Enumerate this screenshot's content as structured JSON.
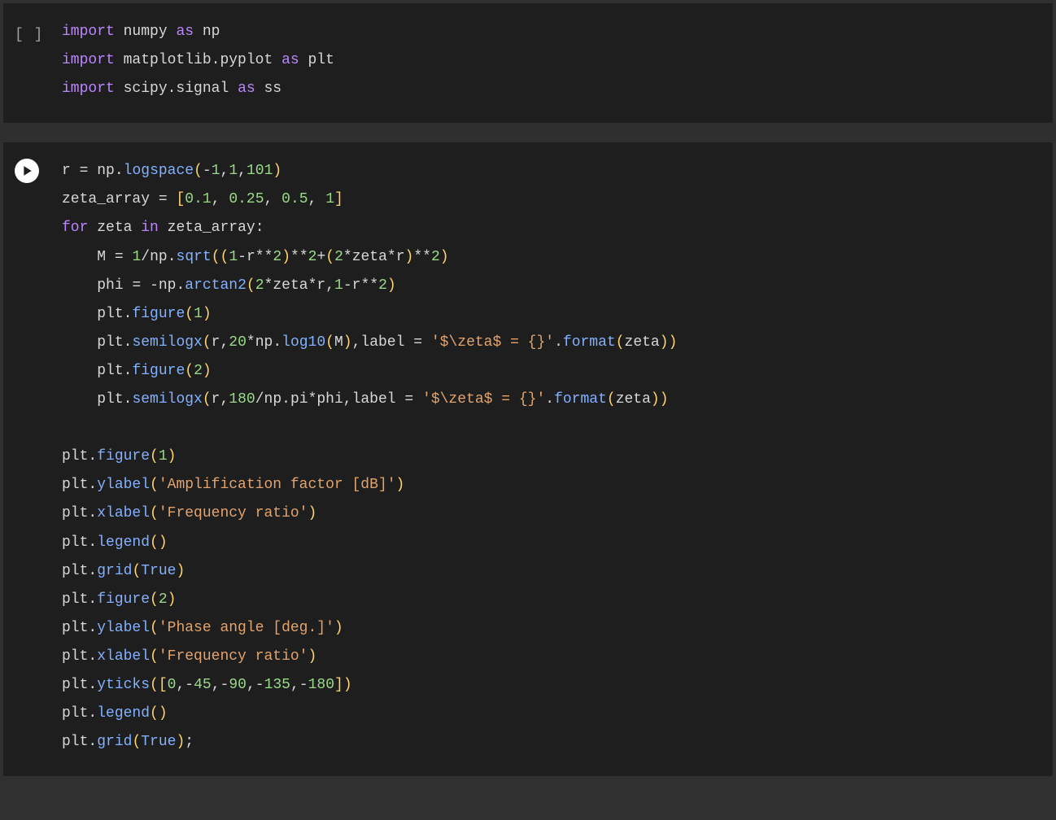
{
  "cells": [
    {
      "state": "idle",
      "gutter": "[ ]",
      "code_html": "<span class=\"kw\">import</span> <span class=\"plain\">numpy</span> <span class=\"kw\">as</span> <span class=\"plain\">np</span>\n<span class=\"kw\">import</span> <span class=\"plain\">matplotlib.pyplot</span> <span class=\"kw\">as</span> <span class=\"plain\">plt</span>\n<span class=\"kw\">import</span> <span class=\"plain\">scipy.signal</span> <span class=\"kw\">as</span> <span class=\"plain\">ss</span>"
    },
    {
      "state": "active",
      "code_html": "<span class=\"plain\">r</span> <span class=\"op\">=</span> <span class=\"plain\">np</span><span class=\"op\">.</span><span class=\"fn\">logspace</span><span class=\"pun\">(</span><span class=\"op\">-</span><span class=\"num\">1</span><span class=\"op\">,</span><span class=\"num\">1</span><span class=\"op\">,</span><span class=\"num\">101</span><span class=\"pun\">)</span>\n<span class=\"plain\">zeta_array</span> <span class=\"op\">=</span> <span class=\"pun\">[</span><span class=\"num\">0.1</span><span class=\"op\">,</span> <span class=\"num\">0.25</span><span class=\"op\">,</span> <span class=\"num\">0.5</span><span class=\"op\">,</span> <span class=\"num\">1</span><span class=\"pun\">]</span>\n<span class=\"kw\">for</span> <span class=\"plain\">zeta</span> <span class=\"kw\">in</span> <span class=\"plain\">zeta_array</span><span class=\"op\">:</span>\n    <span class=\"plain\">M</span> <span class=\"op\">=</span> <span class=\"num\">1</span><span class=\"op\">/</span><span class=\"plain\">np</span><span class=\"op\">.</span><span class=\"fn\">sqrt</span><span class=\"pun\">(</span><span class=\"pun\">(</span><span class=\"num\">1</span><span class=\"op\">-</span><span class=\"plain\">r</span><span class=\"op\">**</span><span class=\"num\">2</span><span class=\"pun\">)</span><span class=\"op\">**</span><span class=\"num\">2</span><span class=\"op\">+</span><span class=\"pun\">(</span><span class=\"num\">2</span><span class=\"op\">*</span><span class=\"plain\">zeta</span><span class=\"op\">*</span><span class=\"plain\">r</span><span class=\"pun\">)</span><span class=\"op\">**</span><span class=\"num\">2</span><span class=\"pun\">)</span>\n    <span class=\"plain\">phi</span> <span class=\"op\">=</span> <span class=\"op\">-</span><span class=\"plain\">np</span><span class=\"op\">.</span><span class=\"fn\">arctan2</span><span class=\"pun\">(</span><span class=\"num\">2</span><span class=\"op\">*</span><span class=\"plain\">zeta</span><span class=\"op\">*</span><span class=\"plain\">r</span><span class=\"op\">,</span><span class=\"num\">1</span><span class=\"op\">-</span><span class=\"plain\">r</span><span class=\"op\">**</span><span class=\"num\">2</span><span class=\"pun\">)</span>\n    <span class=\"plain\">plt</span><span class=\"op\">.</span><span class=\"fn\">figure</span><span class=\"pun\">(</span><span class=\"num\">1</span><span class=\"pun\">)</span>\n    <span class=\"plain\">plt</span><span class=\"op\">.</span><span class=\"fn\">semilogx</span><span class=\"pun\">(</span><span class=\"plain\">r</span><span class=\"op\">,</span><span class=\"num\">20</span><span class=\"op\">*</span><span class=\"plain\">np</span><span class=\"op\">.</span><span class=\"fn\">log10</span><span class=\"pun\">(</span><span class=\"plain\">M</span><span class=\"pun\">)</span><span class=\"op\">,</span><span class=\"plain\">label</span> <span class=\"op\">=</span> <span class=\"str\">'$\\zeta$ = {}'</span><span class=\"op\">.</span><span class=\"fn\">format</span><span class=\"pun\">(</span><span class=\"plain\">zeta</span><span class=\"pun\">)</span><span class=\"pun\">)</span>\n    <span class=\"plain\">plt</span><span class=\"op\">.</span><span class=\"fn\">figure</span><span class=\"pun\">(</span><span class=\"num\">2</span><span class=\"pun\">)</span>\n    <span class=\"plain\">plt</span><span class=\"op\">.</span><span class=\"fn\">semilogx</span><span class=\"pun\">(</span><span class=\"plain\">r</span><span class=\"op\">,</span><span class=\"num\">180</span><span class=\"op\">/</span><span class=\"plain\">np</span><span class=\"op\">.</span><span class=\"plain\">pi</span><span class=\"op\">*</span><span class=\"plain\">phi</span><span class=\"op\">,</span><span class=\"plain\">label</span> <span class=\"op\">=</span> <span class=\"str\">'$\\zeta$ = {}'</span><span class=\"op\">.</span><span class=\"fn\">format</span><span class=\"pun\">(</span><span class=\"plain\">zeta</span><span class=\"pun\">)</span><span class=\"pun\">)</span>\n\n<span class=\"plain\">plt</span><span class=\"op\">.</span><span class=\"fn\">figure</span><span class=\"pun\">(</span><span class=\"num\">1</span><span class=\"pun\">)</span>\n<span class=\"plain\">plt</span><span class=\"op\">.</span><span class=\"fn\">ylabel</span><span class=\"pun\">(</span><span class=\"str\">'Amplification factor [dB]'</span><span class=\"pun\">)</span>\n<span class=\"plain\">plt</span><span class=\"op\">.</span><span class=\"fn\">xlabel</span><span class=\"pun\">(</span><span class=\"str\">'Frequency ratio'</span><span class=\"pun\">)</span>\n<span class=\"plain\">plt</span><span class=\"op\">.</span><span class=\"fn\">legend</span><span class=\"pun\">(</span><span class=\"pun\">)</span>\n<span class=\"plain\">plt</span><span class=\"op\">.</span><span class=\"fn\">grid</span><span class=\"pun\">(</span><span class=\"bool\">True</span><span class=\"pun\">)</span>\n<span class=\"plain\">plt</span><span class=\"op\">.</span><span class=\"fn\">figure</span><span class=\"pun\">(</span><span class=\"num\">2</span><span class=\"pun\">)</span>\n<span class=\"plain\">plt</span><span class=\"op\">.</span><span class=\"fn\">ylabel</span><span class=\"pun\">(</span><span class=\"str\">'Phase angle [deg.]'</span><span class=\"pun\">)</span>\n<span class=\"plain\">plt</span><span class=\"op\">.</span><span class=\"fn\">xlabel</span><span class=\"pun\">(</span><span class=\"str\">'Frequency ratio'</span><span class=\"pun\">)</span>\n<span class=\"plain\">plt</span><span class=\"op\">.</span><span class=\"fn\">yticks</span><span class=\"pun\">(</span><span class=\"pun\">[</span><span class=\"num\">0</span><span class=\"op\">,</span><span class=\"op\">-</span><span class=\"num\">45</span><span class=\"op\">,</span><span class=\"op\">-</span><span class=\"num\">90</span><span class=\"op\">,</span><span class=\"op\">-</span><span class=\"num\">135</span><span class=\"op\">,</span><span class=\"op\">-</span><span class=\"num\">180</span><span class=\"pun\">]</span><span class=\"pun\">)</span>\n<span class=\"plain\">plt</span><span class=\"op\">.</span><span class=\"fn\">legend</span><span class=\"pun\">(</span><span class=\"pun\">)</span>\n<span class=\"plain\">plt</span><span class=\"op\">.</span><span class=\"fn\">grid</span><span class=\"pun\">(</span><span class=\"bool\">True</span><span class=\"pun\">)</span><span class=\"op\">;</span>"
    }
  ],
  "raw_source": {
    "cell1": "import numpy as np\nimport matplotlib.pyplot as plt\nimport scipy.signal as ss",
    "cell2": "r = np.logspace(-1,1,101)\nzeta_array = [0.1, 0.25, 0.5, 1]\nfor zeta in zeta_array:\n    M = 1/np.sqrt((1-r**2)**2+(2*zeta*r)**2)\n    phi = -np.arctan2(2*zeta*r,1-r**2)\n    plt.figure(1)\n    plt.semilogx(r,20*np.log10(M),label = '$\\\\zeta$ = {}'.format(zeta))\n    plt.figure(2)\n    plt.semilogx(r,180/np.pi*phi,label = '$\\\\zeta$ = {}'.format(zeta))\n\nplt.figure(1)\nplt.ylabel('Amplification factor [dB]')\nplt.xlabel('Frequency ratio')\nplt.legend()\nplt.grid(True)\nplt.figure(2)\nplt.ylabel('Phase angle [deg.]')\nplt.xlabel('Frequency ratio')\nplt.yticks([0,-45,-90,-135,-180])\nplt.legend()\nplt.grid(True);"
  }
}
